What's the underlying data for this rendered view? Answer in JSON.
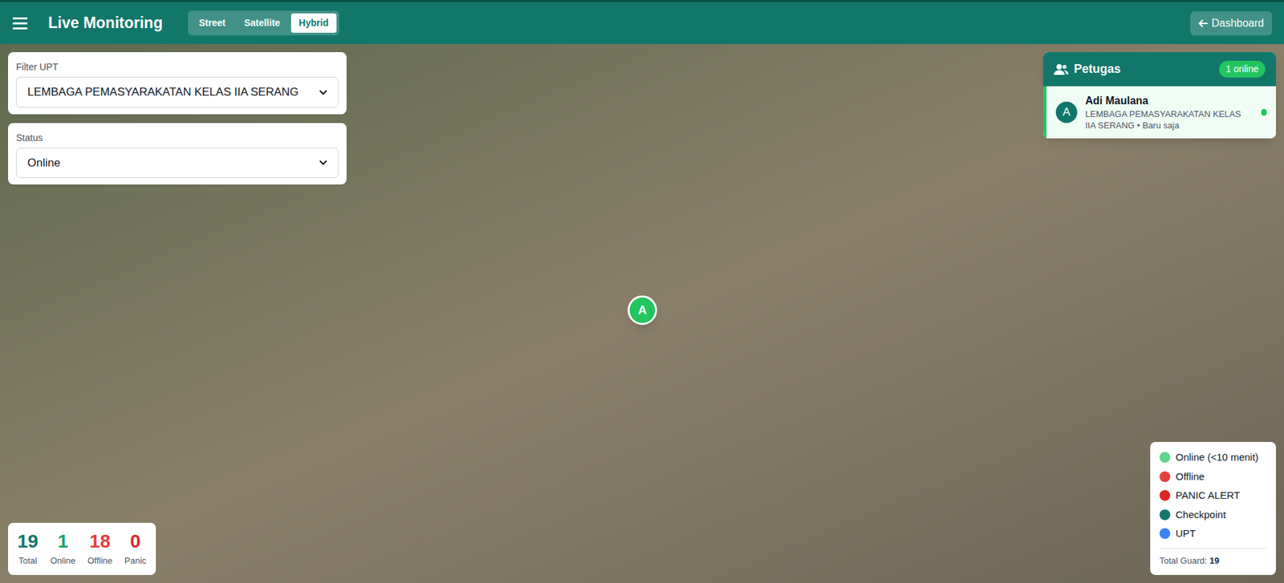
{
  "header": {
    "title": "Live Monitoring",
    "map_types": [
      {
        "label": "Street",
        "selected": false
      },
      {
        "label": "Satellite",
        "selected": false
      },
      {
        "label": "Hybrid",
        "selected": true
      }
    ],
    "dashboard_button": "Dashboard"
  },
  "filters": [
    {
      "label": "Filter UPT",
      "value": "LEMBAGA PEMASYARAKATAN KELAS IIA SERANG"
    },
    {
      "label": "Status",
      "value": "Online"
    }
  ],
  "petugas": {
    "title": "Petugas",
    "badge": "1 online",
    "items": [
      {
        "initial": "A",
        "name": "Adi Maulana",
        "detail": "LEMBAGA PEMASYARAKATAN KELAS IIA SERANG • Baru saja",
        "online": true,
        "color": "#22c55e"
      }
    ]
  },
  "markers": [
    {
      "label": "A",
      "color": "#22c55e"
    }
  ],
  "stats": [
    {
      "value": "19",
      "label": "Total",
      "color": "#12766b"
    },
    {
      "value": "1",
      "label": "Online",
      "color": "#22a06b"
    },
    {
      "value": "18",
      "label": "Offline",
      "color": "#e53e3e"
    },
    {
      "value": "0",
      "label": "Panic",
      "color": "#dc2626"
    }
  ],
  "legend": {
    "items": [
      {
        "label": "Online (<10 menit)",
        "color": "#5fd38d"
      },
      {
        "label": "Offline",
        "color": "#e53e3e"
      },
      {
        "label": "PANIC ALERT",
        "color": "#dc2626"
      },
      {
        "label": "Checkpoint",
        "color": "#12766b"
      },
      {
        "label": "UPT",
        "color": "#3b82f6"
      }
    ],
    "total_label": "Total Guard:",
    "total_value": "19"
  }
}
